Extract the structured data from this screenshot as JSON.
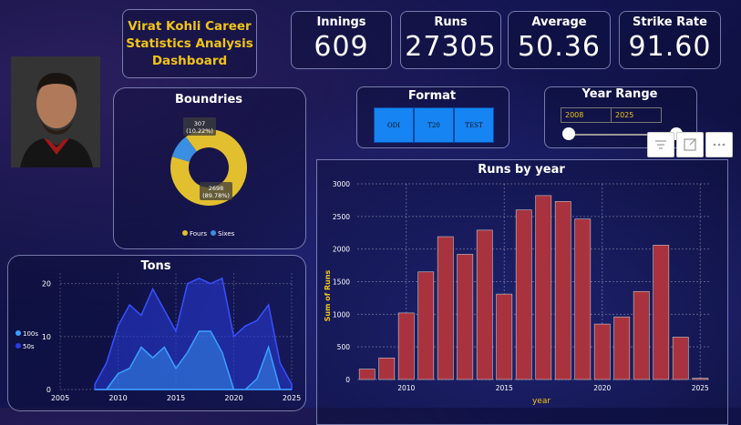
{
  "dashboard": {
    "title": "Virat Kohli Career\nStatistics Analysis\nDashboard"
  },
  "kpis": [
    {
      "label": "Innings",
      "value": "609"
    },
    {
      "label": "Runs",
      "value": "27305"
    },
    {
      "label": "Average",
      "value": "50.36"
    },
    {
      "label": "Strike Rate",
      "value": "91.60"
    }
  ],
  "format": {
    "title": "Format",
    "options": [
      "ODI",
      "T20",
      "TEST"
    ]
  },
  "year_range": {
    "title": "Year Range",
    "start": "2008",
    "end": "2025"
  },
  "colors": {
    "accent": "#f0c419",
    "bar": "#a8333f",
    "fours": "#e2bf2f",
    "sixes": "#3b8fe0",
    "button": "#1684f2"
  },
  "chart_data": [
    {
      "type": "pie",
      "title": "Boundries",
      "slices": [
        {
          "name": "Fours",
          "value": 2698,
          "label_value": "2698",
          "label_pct": "(89.78%)"
        },
        {
          "name": "Sixes",
          "value": 307,
          "label_value": "307",
          "label_pct": "(10.22%)"
        }
      ],
      "legend": [
        "Fours",
        "Sixes"
      ],
      "legend_position": "bottom"
    },
    {
      "type": "area",
      "title": "Tons",
      "x": [
        2008,
        2009,
        2010,
        2011,
        2012,
        2013,
        2014,
        2015,
        2016,
        2017,
        2018,
        2019,
        2020,
        2021,
        2022,
        2023,
        2024,
        2025
      ],
      "series": [
        {
          "name": "100s",
          "values": [
            0,
            0,
            3,
            4,
            8,
            6,
            8,
            4,
            7,
            11,
            11,
            7,
            0,
            0,
            2,
            8,
            0,
            0
          ]
        },
        {
          "name": "50s",
          "values": [
            1,
            5,
            12,
            16,
            14,
            19,
            15,
            11,
            20,
            21,
            20,
            21,
            10,
            12,
            13,
            16,
            5,
            1
          ]
        }
      ],
      "xticks": [
        "2005",
        "2010",
        "2015",
        "2020",
        "2025"
      ],
      "yticks": [
        "0",
        "10",
        "20"
      ],
      "xlim": [
        2005,
        2025
      ],
      "ylim": [
        0,
        22
      ],
      "legend_position": "left"
    },
    {
      "type": "bar",
      "title": "Runs by year",
      "xlabel": "year",
      "ylabel": "Sum of Runs",
      "categories": [
        2008,
        2009,
        2010,
        2011,
        2012,
        2013,
        2014,
        2015,
        2016,
        2017,
        2018,
        2019,
        2020,
        2021,
        2022,
        2023,
        2024,
        2025
      ],
      "values": [
        160,
        330,
        1020,
        1650,
        2190,
        1920,
        2290,
        1310,
        2600,
        2820,
        2730,
        2460,
        850,
        960,
        1350,
        2060,
        650,
        20
      ],
      "yticks": [
        "0",
        "500",
        "1000",
        "1500",
        "2000",
        "2500",
        "3000"
      ],
      "xticks": [
        "2010",
        "2015",
        "2020",
        "2025"
      ],
      "ylim": [
        0,
        3000
      ],
      "grid": true
    }
  ]
}
